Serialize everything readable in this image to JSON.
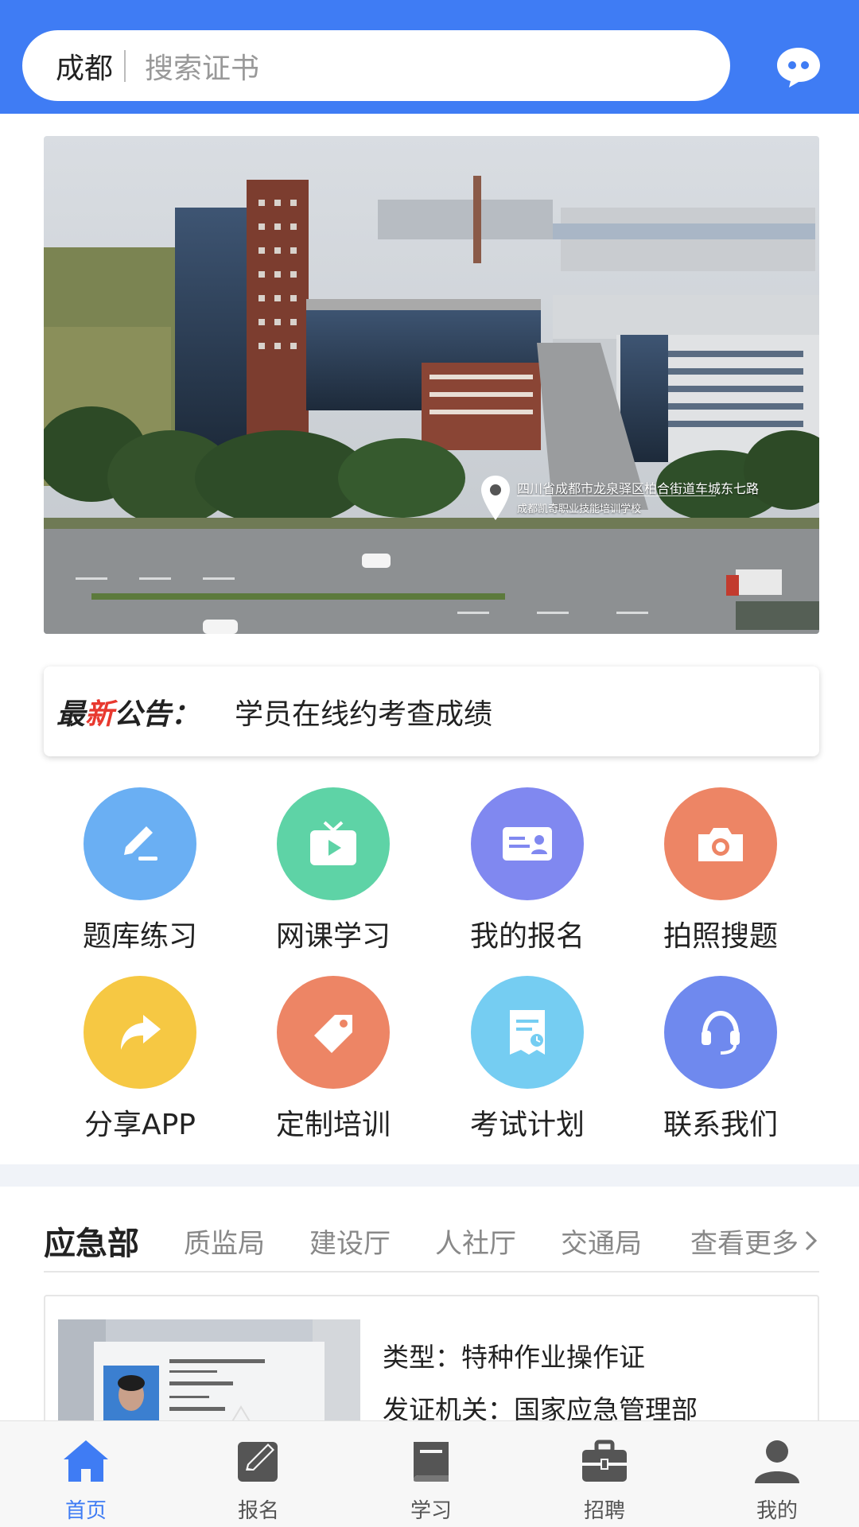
{
  "header": {
    "city": "成都",
    "search_placeholder": "搜索证书",
    "message_icon": "chat-bubble-icon"
  },
  "banner": {
    "address_line1": "四川省成都市龙泉驿区柏合街道车城东七路",
    "address_line2": "成都凯奇职业技能培训学校"
  },
  "notice": {
    "label_prefix": "最",
    "label_highlight": "新",
    "label_suffix": "公告：",
    "text": "学员在线约考查成绩"
  },
  "shortcuts": [
    {
      "label": "题库练习",
      "icon": "pen-icon",
      "color": "#6aaff3"
    },
    {
      "label": "网课学习",
      "icon": "tv-play-icon",
      "color": "#5ed3a6"
    },
    {
      "label": "我的报名",
      "icon": "id-card-icon",
      "color": "#8088f0"
    },
    {
      "label": "拍照搜题",
      "icon": "camera-icon",
      "color": "#ed8565"
    },
    {
      "label": "分享APP",
      "icon": "share-arrow-icon",
      "color": "#f6c843"
    },
    {
      "label": "定制培训",
      "icon": "tag-icon",
      "color": "#ed8565"
    },
    {
      "label": "考试计划",
      "icon": "plan-doc-icon",
      "color": "#75cdf2"
    },
    {
      "label": "联系我们",
      "icon": "headset-icon",
      "color": "#6f89ee"
    }
  ],
  "tabs": {
    "active": "应急部",
    "items": [
      "质监局",
      "建设厅",
      "人社厅",
      "交通局"
    ],
    "more": "查看更多"
  },
  "card": {
    "type_label": "类型：",
    "type_value": "特种作业操作证",
    "issuer_label": "发证机关：",
    "issuer_value": "国家应急管理部"
  },
  "nav": [
    {
      "label": "首页",
      "icon": "home-icon",
      "active": true
    },
    {
      "label": "报名",
      "icon": "edit-icon",
      "active": false
    },
    {
      "label": "学习",
      "icon": "book-icon",
      "active": false
    },
    {
      "label": "招聘",
      "icon": "briefcase-icon",
      "active": false
    },
    {
      "label": "我的",
      "icon": "user-icon",
      "active": false
    }
  ],
  "colors": {
    "brand": "#3f7cf4",
    "notice_highlight": "#e8392f"
  }
}
